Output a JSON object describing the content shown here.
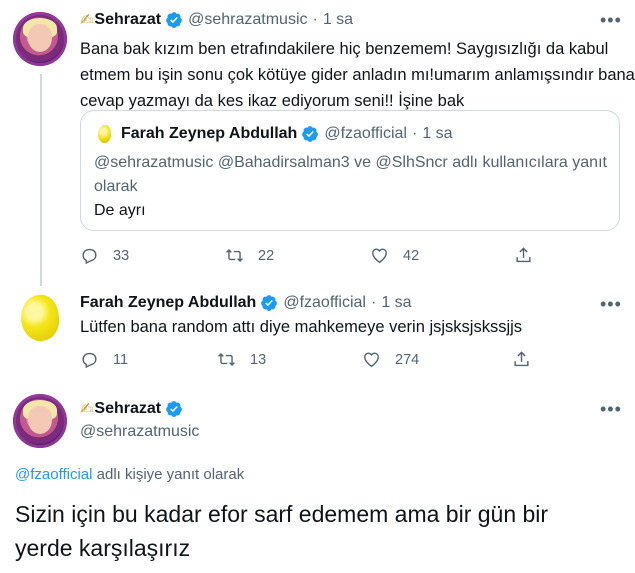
{
  "tweet1": {
    "pen_emoji": "✍",
    "display_name": "Sehrazat",
    "handle": "@sehrazatmusic",
    "separator": "·",
    "time": "1 sa",
    "text_line1": "Bana bak kızım ben etrafındakilere hiç benzemem! Saygısızlığı da kabul",
    "text_line2": "etmem bu işin sonu çok kötüye gider anladın mı!umarım anlamışsındır bana",
    "text_line3": "cevap yazmayı da kes ikaz ediyorum seni!! İşine bak",
    "quote": {
      "display_name": "Farah Zeynep Abdullah",
      "handle": "@fzaofficial",
      "separator": "·",
      "time": "1 sa",
      "reply_line1": "@sehrazatmusic @Bahadirsalman3 ve @SlhSncr adlı kullanıcılara yanıt",
      "reply_line2": "olarak",
      "text": "De ayrı"
    },
    "actions": {
      "replies": "33",
      "retweets": "22",
      "likes": "42"
    }
  },
  "tweet2": {
    "display_name": "Farah Zeynep Abdullah",
    "handle": "@fzaofficial",
    "separator": "·",
    "time": "1 sa",
    "text": "Lütfen bana random attı diye mahkemeye verin jsjsksjskssjjs",
    "actions": {
      "replies": "11",
      "retweets": "13",
      "likes": "274"
    }
  },
  "tweet3": {
    "pen_emoji": "✍",
    "display_name": "Sehrazat",
    "handle": "@sehrazatmusic",
    "reply_mention": "@fzaofficial",
    "reply_suffix": " adlı kişiye yanıt olarak",
    "text_line1": "Sizin için bu kadar efor sarf edemem ama bir gün bir",
    "text_line2": "yerde karşılaşırız"
  },
  "more_label": "•••",
  "colors": {
    "verified": "#1d9bf0",
    "link": "#1d9bf0",
    "secondary_text": "#536471",
    "border": "#cfd9de"
  },
  "icons": [
    "verified-icon",
    "reply-icon",
    "retweet-icon",
    "like-icon",
    "share-icon",
    "more-icon"
  ]
}
